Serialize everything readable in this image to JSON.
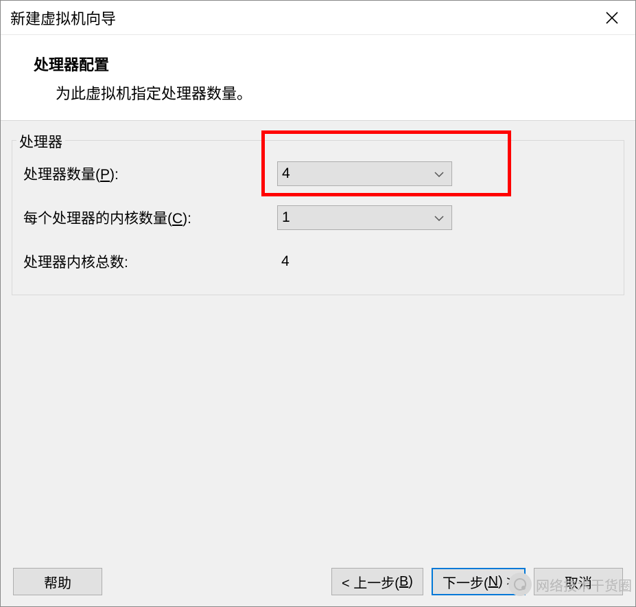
{
  "title": "新建虚拟机向导",
  "header": {
    "title": "处理器配置",
    "subtitle": "为此虚拟机指定处理器数量。"
  },
  "group": {
    "label": "处理器",
    "rows": {
      "processor_count": {
        "label_prefix": "处理器数量(",
        "label_key": "P",
        "label_suffix": "):",
        "value": "4"
      },
      "cores_per_processor": {
        "label_prefix": "每个处理器的内核数量(",
        "label_key": "C",
        "label_suffix": "):",
        "value": "1"
      },
      "total_cores": {
        "label": "处理器内核总数:",
        "value": "4"
      }
    }
  },
  "buttons": {
    "help": "帮助",
    "back_prefix": "< 上一步(",
    "back_key": "B",
    "back_suffix": ")",
    "next_prefix": "下一步(",
    "next_key": "N",
    "next_suffix": ") >",
    "cancel": "取消"
  },
  "watermark": "网络技术干货圈"
}
